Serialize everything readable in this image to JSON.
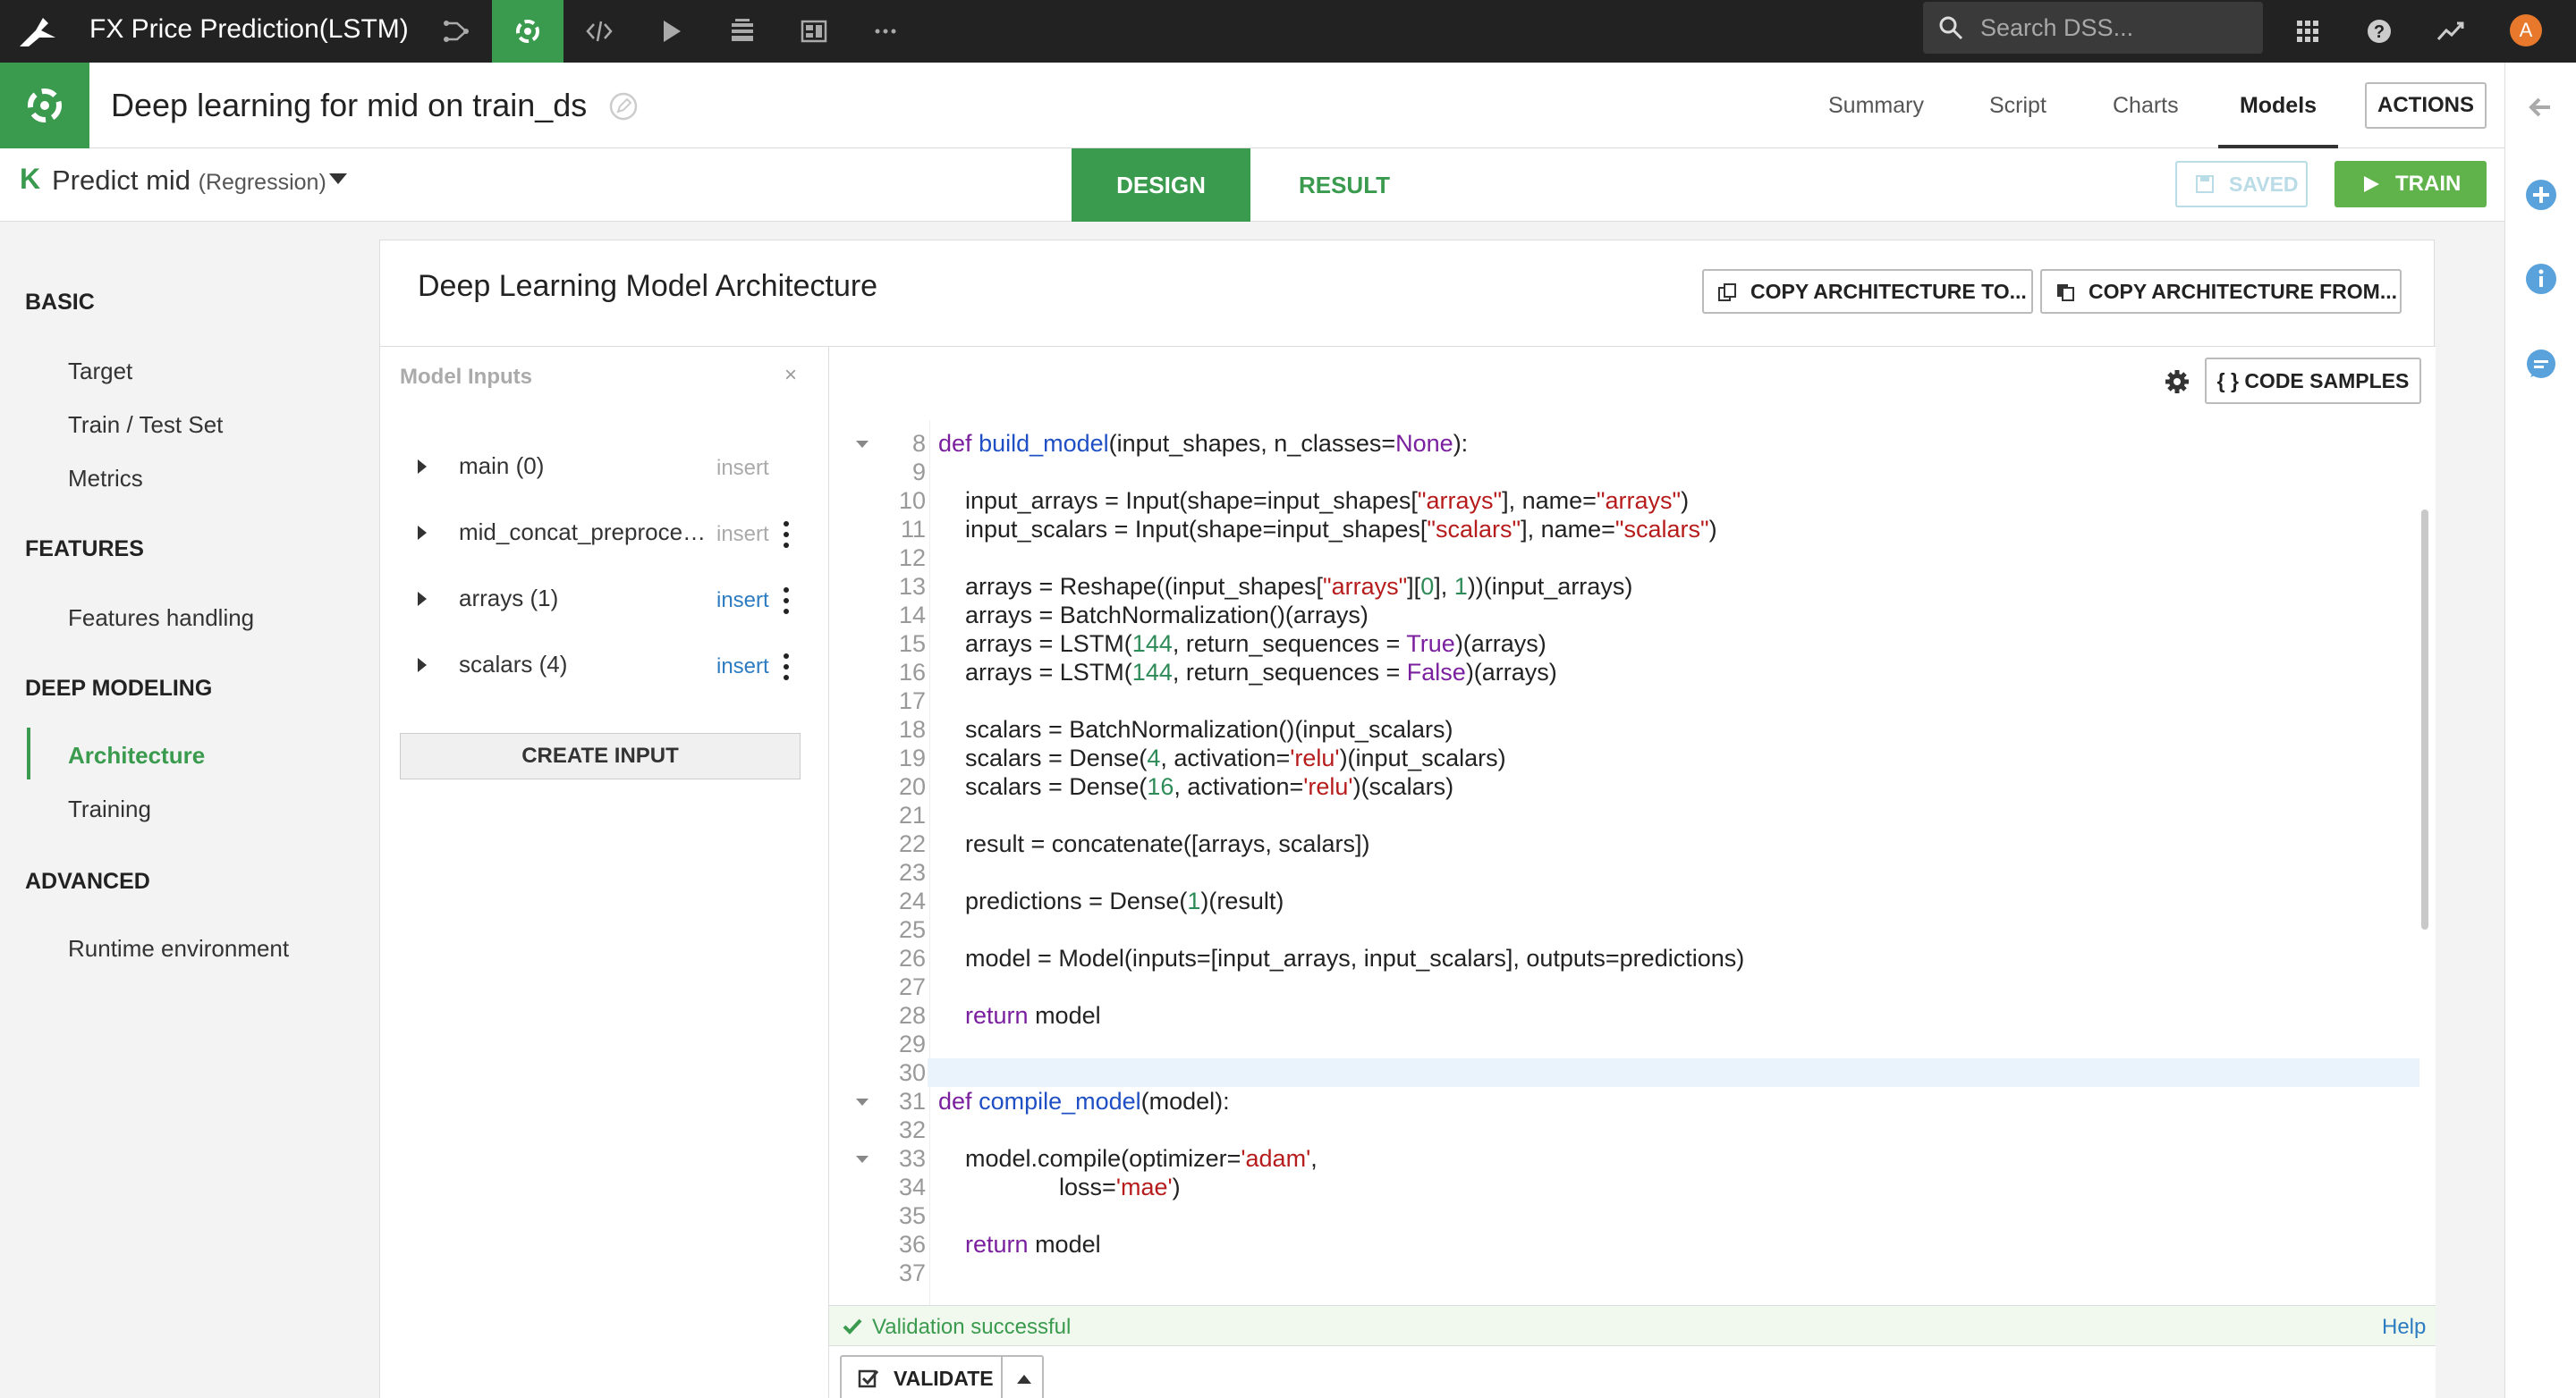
{
  "topnav": {
    "project_title": "FX Price Prediction(LSTM)",
    "icons": [
      "flow-icon",
      "lab-icon",
      "code-icon",
      "run-icon",
      "datasets-icon",
      "dashboard-icon",
      "more-icon"
    ],
    "search_placeholder": "Search DSS...",
    "avatar_letter": "A"
  },
  "header": {
    "model_title": "Deep learning for mid on train_ds",
    "tabs": [
      "Summary",
      "Script",
      "Charts",
      "Models"
    ],
    "active_tab": "Models",
    "actions_label": "ACTIONS"
  },
  "subheader": {
    "k_letter": "K",
    "task": "Predict mid",
    "task_type": "(Regression)",
    "design_label": "DESIGN",
    "result_label": "RESULT",
    "saved_label": "SAVED",
    "train_label": "TRAIN"
  },
  "leftnav": {
    "sections": [
      {
        "title": "BASIC",
        "items": [
          "Target",
          "Train / Test Set",
          "Metrics"
        ]
      },
      {
        "title": "FEATURES",
        "items": [
          "Features handling"
        ]
      },
      {
        "title": "DEEP MODELING",
        "items": [
          "Architecture",
          "Training"
        ]
      },
      {
        "title": "ADVANCED",
        "items": [
          "Runtime environment"
        ]
      }
    ],
    "active_item": "Architecture"
  },
  "card": {
    "title": "Deep Learning Model Architecture",
    "copy_to_label": "COPY ARCHITECTURE TO...",
    "copy_from_label": "COPY ARCHITECTURE FROM..."
  },
  "inputs": {
    "header": "Model Inputs",
    "close_glyph": "×",
    "rows": [
      {
        "name": "main (0)",
        "insert": "insert"
      },
      {
        "name": "mid_concat_preprocessed",
        "insert": "insert"
      },
      {
        "name": "arrays (1)",
        "insert": "insert"
      },
      {
        "name": "scalars (4)",
        "insert": "insert"
      }
    ],
    "create_label": "CREATE INPUT"
  },
  "editor": {
    "code_samples_label": "{ }  CODE SAMPLES",
    "lines": [
      {
        "n": "8",
        "text": "def build_model(input_shapes, n_classes=None):"
      },
      {
        "n": "9",
        "text": ""
      },
      {
        "n": "10",
        "text": "    input_arrays = Input(shape=input_shapes[\"arrays\"], name=\"arrays\")"
      },
      {
        "n": "11",
        "text": "    input_scalars = Input(shape=input_shapes[\"scalars\"], name=\"scalars\")"
      },
      {
        "n": "12",
        "text": ""
      },
      {
        "n": "13",
        "text": "    arrays = Reshape((input_shapes[\"arrays\"][0], 1))(input_arrays)"
      },
      {
        "n": "14",
        "text": "    arrays = BatchNormalization()(arrays)"
      },
      {
        "n": "15",
        "text": "    arrays = LSTM(144, return_sequences = True)(arrays)"
      },
      {
        "n": "16",
        "text": "    arrays = LSTM(144, return_sequences = False)(arrays)"
      },
      {
        "n": "17",
        "text": ""
      },
      {
        "n": "18",
        "text": "    scalars = BatchNormalization()(input_scalars)"
      },
      {
        "n": "19",
        "text": "    scalars = Dense(4, activation='relu')(input_scalars)"
      },
      {
        "n": "20",
        "text": "    scalars = Dense(16, activation='relu')(scalars)"
      },
      {
        "n": "21",
        "text": ""
      },
      {
        "n": "22",
        "text": "    result = concatenate([arrays, scalars])"
      },
      {
        "n": "23",
        "text": ""
      },
      {
        "n": "24",
        "text": "    predictions = Dense(1)(result)"
      },
      {
        "n": "25",
        "text": ""
      },
      {
        "n": "26",
        "text": "    model = Model(inputs=[input_arrays, input_scalars], outputs=predictions)"
      },
      {
        "n": "27",
        "text": ""
      },
      {
        "n": "28",
        "text": "    return model"
      },
      {
        "n": "29",
        "text": ""
      },
      {
        "n": "30",
        "text": ""
      },
      {
        "n": "31",
        "text": "def compile_model(model):"
      },
      {
        "n": "32",
        "text": ""
      },
      {
        "n": "33",
        "text": "    model.compile(optimizer='adam',"
      },
      {
        "n": "34",
        "text": "                  loss='mae')"
      },
      {
        "n": "35",
        "text": ""
      },
      {
        "n": "36",
        "text": "    return model"
      },
      {
        "n": "37",
        "text": ""
      }
    ],
    "folded_lines": [
      "8",
      "31",
      "33"
    ],
    "active_line": "30"
  },
  "status": {
    "message": "Validation successful",
    "help": "Help",
    "validate_label": "VALIDATE"
  },
  "colors": {
    "brand_green": "#3a9a4e",
    "train_green": "#60b24a",
    "link_blue": "#2d7cc1",
    "topbar": "#222222"
  }
}
